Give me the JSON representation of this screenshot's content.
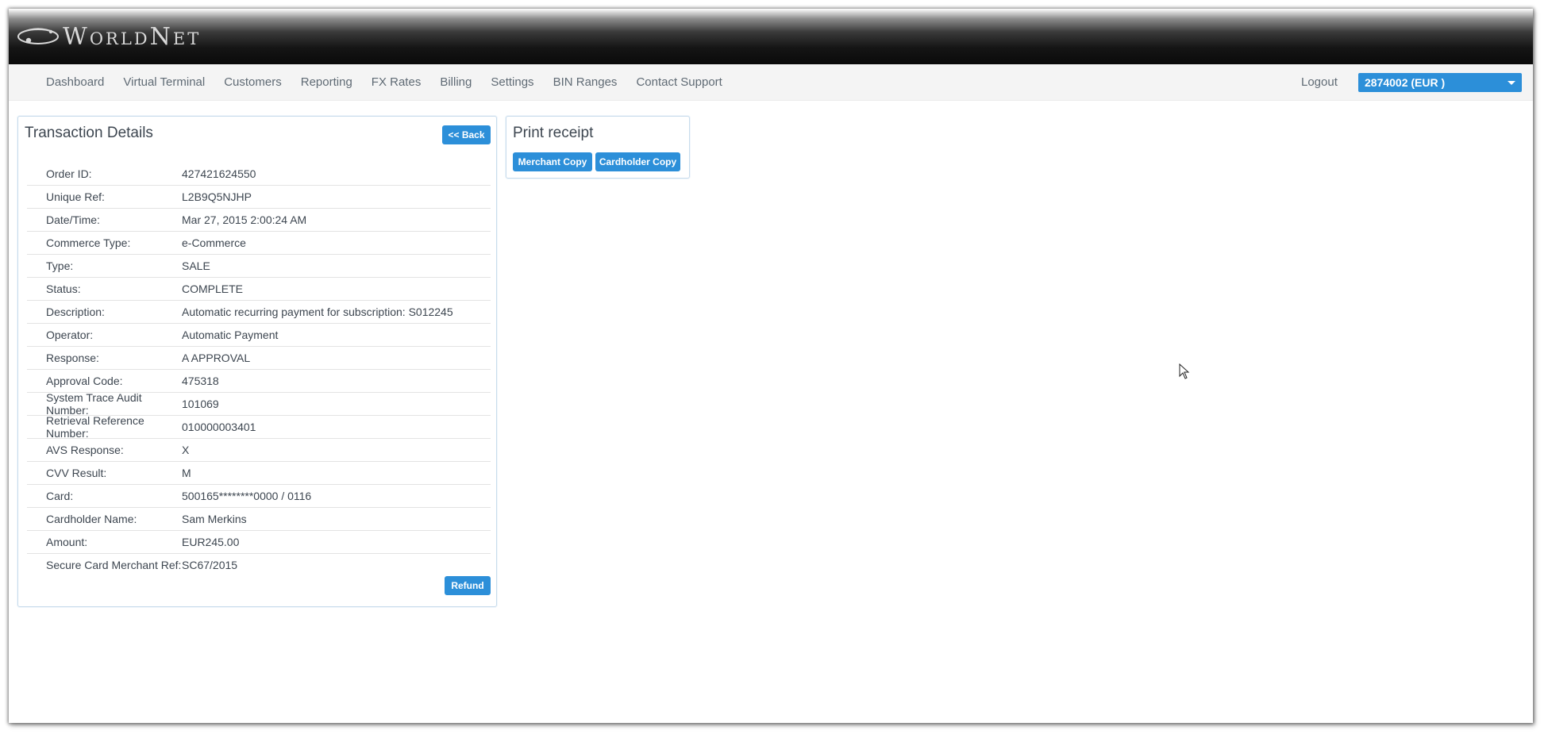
{
  "brand": {
    "name": "WorldNet"
  },
  "nav": {
    "items": [
      "Dashboard",
      "Virtual Terminal",
      "Customers",
      "Reporting",
      "FX Rates",
      "Billing",
      "Settings",
      "BIN Ranges",
      "Contact Support"
    ],
    "logout": "Logout",
    "account": "2874002 (EUR )"
  },
  "details": {
    "title": "Transaction Details",
    "back_label": "<< Back",
    "refund_label": "Refund",
    "rows": [
      {
        "label": "Order ID:",
        "value": "427421624550"
      },
      {
        "label": "Unique Ref:",
        "value": "L2B9Q5NJHP"
      },
      {
        "label": "Date/Time:",
        "value": "Mar 27, 2015 2:00:24 AM"
      },
      {
        "label": "Commerce Type:",
        "value": "e-Commerce"
      },
      {
        "label": "Type:",
        "value": "SALE"
      },
      {
        "label": "Status:",
        "value": "COMPLETE"
      },
      {
        "label": "Description:",
        "value": "Automatic recurring payment for subscription: S012245"
      },
      {
        "label": "Operator:",
        "value": "Automatic Payment"
      },
      {
        "label": "Response:",
        "value": "A APPROVAL"
      },
      {
        "label": "Approval Code:",
        "value": "475318"
      },
      {
        "label": "System Trace Audit Number:",
        "value": "101069"
      },
      {
        "label": "Retrieval Reference Number:",
        "value": "010000003401"
      },
      {
        "label": "AVS Response:",
        "value": "X"
      },
      {
        "label": "CVV Result:",
        "value": "M"
      },
      {
        "label": "Card:",
        "value": "500165********0000 / 0116"
      },
      {
        "label": "Cardholder Name:",
        "value": "Sam Merkins"
      },
      {
        "label": "Amount:",
        "value": "EUR245.00"
      },
      {
        "label": "Secure Card Merchant Ref:",
        "value": "SC67/2015"
      }
    ]
  },
  "print": {
    "title": "Print receipt",
    "merchant_label": "Merchant Copy",
    "cardholder_label": "Cardholder Copy"
  },
  "colors": {
    "accent": "#2c8fd9",
    "text": "#3d4650",
    "nav_text": "#5f6a74"
  }
}
